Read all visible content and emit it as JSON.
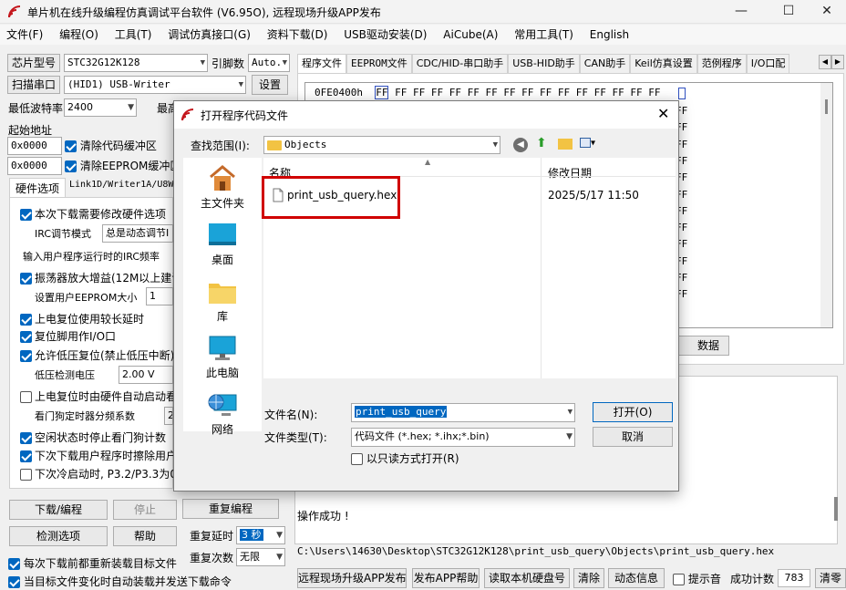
{
  "window": {
    "title": "单片机在线升级编程仿真调试平台软件 (V6.95O), 远程现场升级APP发布",
    "minimize": "—",
    "maximize": "☐",
    "close": "✕"
  },
  "menu": [
    "文件(F)",
    "编程(O)",
    "工具(T)",
    "调试仿真接口(G)",
    "资料下载(D)",
    "USB驱动安装(D)",
    "AiCube(A)",
    "常用工具(T)",
    "English"
  ],
  "left": {
    "chip_label": "芯片型号",
    "chip_value": "STC32G12K128",
    "pins_label": "引脚数",
    "pins_value": "Auto.",
    "scan_label": "扫描串口",
    "port_value": "(HID1) USB-Writer",
    "settings_label": "设置",
    "min_baud_label": "最低波特率",
    "min_baud_value": "2400",
    "max_baud_label": "最高",
    "start_addr_label": "起始地址",
    "addr1": "0x0000",
    "clear_code_label": "清除代码缓冲区",
    "addr2": "0x0000",
    "clear_eeprom_label": "清除EEPROM缓冲区",
    "tab_hw": "硬件选项",
    "tab_link": "Link1D/Writer1A/U8W",
    "opt_modify_hw": "本次下载需要修改硬件选项",
    "irc_mode_label": "IRC调节模式",
    "irc_mode_value": "总是动态调节I",
    "irc_freq_label": "输入用户程序运行时的IRC频率",
    "osc_gain": "振荡器放大增益(12M以上建议",
    "eeprom_size_label": "设置用户EEPROM大小",
    "eeprom_size_value": "1",
    "long_reset": "上电复位使用较长延时",
    "reset_io": "复位脚用作I/O口",
    "lvd_reset": "允许低压复位(禁止低压中断)",
    "lvd_label": "低压检测电压",
    "lvd_value": "2.00 V",
    "wdt_auto": "上电复位时由硬件自动启动看",
    "wdt_div_label": "看门狗定时器分频系数",
    "wdt_div_value": "2",
    "idle_wdt": "空闲状态时停止看门狗计数",
    "erase_user": "下次下载用户程序时擦除用户",
    "cold_boot": "下次冷启动时, P3.2/P3.3为0",
    "download_btn": "下载/编程",
    "stop_btn": "停止",
    "reprog_btn": "重复编程",
    "check_btn": "检测选项",
    "help_btn": "帮助",
    "repeat_delay_label": "重复延时",
    "repeat_delay_value": "3 秒",
    "repeat_count_label": "重复次数",
    "repeat_count_value": "无限",
    "reload_each": "每次下载前都重新装载目标文件",
    "auto_reload": "当目标文件变化时自动装载并发送下载命令"
  },
  "right": {
    "tabs": [
      "程序文件",
      "EEPROM文件",
      "CDC/HID-串口助手",
      "USB-HID助手",
      "CAN助手",
      "Keil仿真设置",
      "范例程序",
      "I/O口配"
    ],
    "hex_addr": "0FE0400h",
    "hex_first": "FF",
    "hex_line": "FF FF FF FF FF FF FF FF FF FF FF FF FF FF FF",
    "hex_col_cell": "FF",
    "data_btn_fragment": "数据",
    "log_text": "操作成功 !",
    "path": "C:\\Users\\14630\\Desktop\\STC32G12K128\\print_usb_query\\Objects\\print_usb_query.hex",
    "bottom_buttons": [
      "远程现场升级APP发布",
      "发布APP帮助",
      "读取本机硬盘号",
      "清除",
      "动态信息"
    ],
    "beep_label": "提示音",
    "success_label": "成功计数",
    "success_count": "783",
    "clear_count": "清零"
  },
  "dialog": {
    "title": "打开程序代码文件",
    "lookin_label": "查找范围(I):",
    "lookin_value": "Objects",
    "places": [
      "主文件夹",
      "桌面",
      "库",
      "此电脑",
      "网络"
    ],
    "col_name": "名称",
    "col_date": "修改日期",
    "file_name": "print_usb_query.hex",
    "file_date": "2025/5/17 11:50",
    "filename_label": "文件名(N):",
    "filename_value": "print_usb_query",
    "filetype_label": "文件类型(T):",
    "filetype_value": "代码文件 (*.hex; *.ihx;*.bin)",
    "readonly_label": "以只读方式打开(R)",
    "open_btn": "打开(O)",
    "cancel_btn": "取消",
    "highlight_color": "#d00000"
  }
}
